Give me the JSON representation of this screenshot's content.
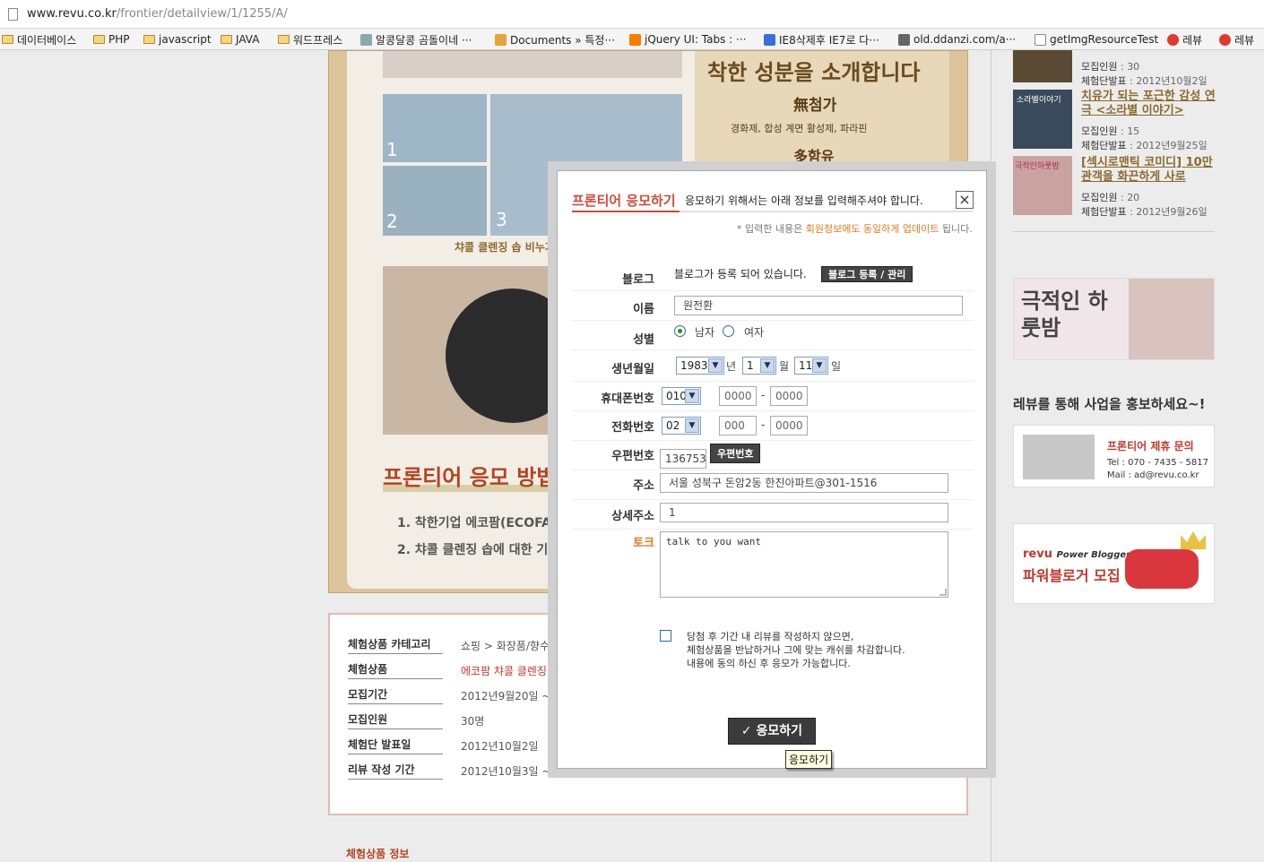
{
  "browser": {
    "url_host": "www.revu.co.kr",
    "url_path": "/frontier/detailview/1/1255/A/"
  },
  "bookmarks": [
    {
      "label": "데이터베이스",
      "icon": "folder-icon"
    },
    {
      "label": "PHP",
      "icon": "folder-icon"
    },
    {
      "label": "javascript",
      "icon": "folder-icon"
    },
    {
      "label": "JAVA",
      "icon": "folder-icon"
    },
    {
      "label": "워드프레스",
      "icon": "folder-icon"
    },
    {
      "label": "알콩달콩 곰돌이네 ···",
      "icon": "site-icon"
    },
    {
      "label": "Documents » 특정···",
      "icon": "site-icon"
    },
    {
      "label": "jQuery UI: Tabs : ···",
      "icon": "blogger-icon"
    },
    {
      "label": "IE8삭제후 IE7로 다···",
      "icon": "site-icon"
    },
    {
      "label": "old.ddanzi.com/a···",
      "icon": "site-icon"
    },
    {
      "label": "getImgResourceTest",
      "icon": "page-icon"
    },
    {
      "label": "레뷰",
      "icon": "revu-icon"
    },
    {
      "label": "레뷰",
      "icon": "revu-icon"
    }
  ],
  "content": {
    "intro_title": "착한 성분을 소개합니다",
    "intro_sub": "無첨가",
    "intro_sub2": "경화제, 합성 계면 활성제, 파라핀",
    "intro_sub3": "多함유",
    "step_nums": [
      "1",
      "2",
      "3"
    ],
    "soap_caption": "챠콜 클렌징 솝 비누거품",
    "apply_method_title": "프론티어 응모 방법",
    "apply_steps": [
      "1. 착한기업 에코팜(ECOFARM)",
      "2. 챠콜 클렌징 솝에 대한 기대평"
    ]
  },
  "info": [
    {
      "key": "체험상품 카테고리",
      "value": "쇼핑 > 화장품/향수",
      "red": false
    },
    {
      "key": "체험상품",
      "value": "에코팜 챠콜 클렌징",
      "red": true
    },
    {
      "key": "모집기간",
      "value": "2012년9월20일 ~ 2",
      "red": false
    },
    {
      "key": "모집인원",
      "value": "30명",
      "red": false
    },
    {
      "key": "체험단 발표일",
      "value": "2012년10월2일",
      "red": false
    },
    {
      "key": "리뷰 작성 기간",
      "value": "2012년10월3일 ~ 2",
      "red": false
    }
  ],
  "bottom_title": "체험상품 정보",
  "sidebar": {
    "items": [
      {
        "title": "",
        "count_label": "모집인원",
        "count": "30",
        "date_label": "체험단발표",
        "date": "2012년10월2일"
      },
      {
        "title": "치유가 되는 포근한 감성 연극 <소라별 이야기>",
        "count_label": "모집인원",
        "count": "15",
        "date_label": "체험단발표",
        "date": "2012년9월25일"
      },
      {
        "title": "[섹시로맨틱 코미디] 10만 관객을 화끈하게 사로",
        "count_label": "모집인원",
        "count": "20",
        "date_label": "체험단발표",
        "date": "2012년9월26일"
      }
    ],
    "thumb_label_1": "소라별이야기",
    "thumb_label_2": "극적인하룻밤",
    "banner1_text": "극적인 하룻밤",
    "promo_heading": "레뷰를 통해 사업을 홍보하세요~!",
    "banner2_title": "프론티어 제휴 문의",
    "banner2_tel": "Tel : 070 - 7435 - 5817",
    "banner2_mail": "Mail : ad@revu.co.kr",
    "banner3_brand": "revu",
    "banner3_brand_sub": "Power Blogger",
    "banner3_title": "파워블로거 모집"
  },
  "modal": {
    "title": "프론티어 응모하기",
    "description": "응모하기 위해서는 아래 정보를 입력해주셔야 합니다.",
    "close": "×",
    "note_prefix": "* 입력한 내용은",
    "note_highlight": "회원정보에도 동일하게 업데이트",
    "note_suffix": "됩니다.",
    "blog_label": "블로그",
    "blog_text": "블로그가 등록 되어 있습니다.",
    "blog_button": "블로그 등록 / 관리",
    "name_label": "이름",
    "name_value": "원전환",
    "gender_label": "성별",
    "gender_male": "남자",
    "gender_female": "여자",
    "birth_label": "생년월일",
    "birth_year": "1983",
    "birth_year_unit": "년",
    "birth_month": "1",
    "birth_month_unit": "월",
    "birth_day": "11",
    "birth_day_unit": "일",
    "mobile_label": "휴대폰번호",
    "mobile_prefix": "010",
    "mobile_mid": "0000",
    "mobile_last": "0000",
    "phone_label": "전화번호",
    "phone_prefix": "02",
    "phone_mid": "000",
    "phone_last": "0000",
    "dash": "-",
    "zip_label": "우편번호",
    "zip_value": "136753",
    "zip_button": "우편번호",
    "addr_label": "주소",
    "addr_value": "서울 성북구 돈암2동 한진아파트@301-1516",
    "addr_detail_label": "상세주소",
    "addr_detail_value": "1",
    "talk_label": "토크",
    "talk_value": "talk to you want",
    "agree_line1": "당첨 후 기간 내 리뷰를 작성하지 않으면,",
    "agree_line2": "체험상품을 반납하거나 그에 맞는 캐쉬를 차감합니다.",
    "agree_line3": "내용에 동의 하신 후 응모가 가능합니다.",
    "submit_label": "응모하기",
    "tooltip": "응모하기"
  }
}
